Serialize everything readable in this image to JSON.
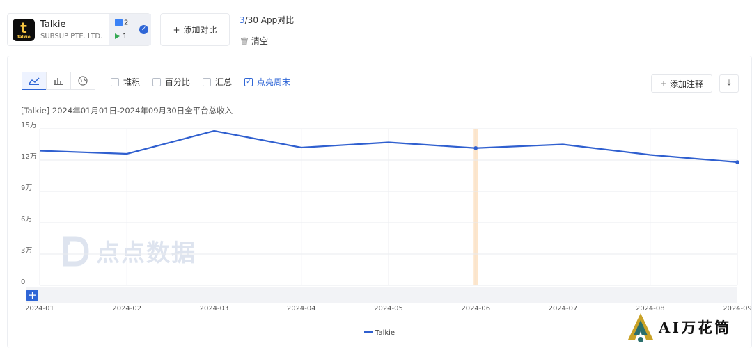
{
  "app": {
    "name": "Talkie",
    "developer": "SUBSUP PTE. LTD.",
    "icon_label": "Talkie",
    "ios_count": "2",
    "gp_count": "1"
  },
  "header": {
    "add_compare": "添加对比",
    "count_current": "3",
    "count_rest": "/30 App对比",
    "clear": "清空"
  },
  "toolbar": {
    "icons": [
      "line-chart-icon",
      "bar-chart-icon",
      "globe-icon"
    ],
    "checkboxes": [
      {
        "label": "堆积",
        "checked": false
      },
      {
        "label": "百分比",
        "checked": false
      },
      {
        "label": "汇总",
        "checked": false
      },
      {
        "label": "点亮周末",
        "checked": true
      }
    ],
    "add_annotation": "添加注释"
  },
  "watermark": "点点数据",
  "brand": "AI万花筒",
  "colors": {
    "accent": "#2f66d6",
    "line": "#2f5fcf",
    "highlight": "#fde6cc"
  },
  "chart_data": {
    "type": "line",
    "title": "[Talkie] 2024年01月01日-2024年09月30日全平台总收入",
    "x": [
      "2024-01",
      "2024-02",
      "2024-03",
      "2024-04",
      "2024-05",
      "2024-06",
      "2024-07",
      "2024-08",
      "2024-09"
    ],
    "x_tick_labels": [
      "2024-01",
      "2024-02",
      "2024-03",
      "2024-04",
      "2024-05",
      "2024-06",
      "2024-07",
      "2024-08",
      "2024-09"
    ],
    "series": [
      {
        "name": "Talkie",
        "values": [
          129000,
          126000,
          148000,
          132000,
          137000,
          131500,
          135000,
          125000,
          118000
        ]
      }
    ],
    "ylim": [
      0,
      150000
    ],
    "y_ticks": [
      0,
      30000,
      60000,
      90000,
      120000,
      150000
    ],
    "y_tick_labels": [
      "0",
      "3万",
      "6万",
      "9万",
      "12万",
      "15万"
    ],
    "highlighted_category": "2024-06",
    "grid": true,
    "legend_position": "bottom-center"
  }
}
